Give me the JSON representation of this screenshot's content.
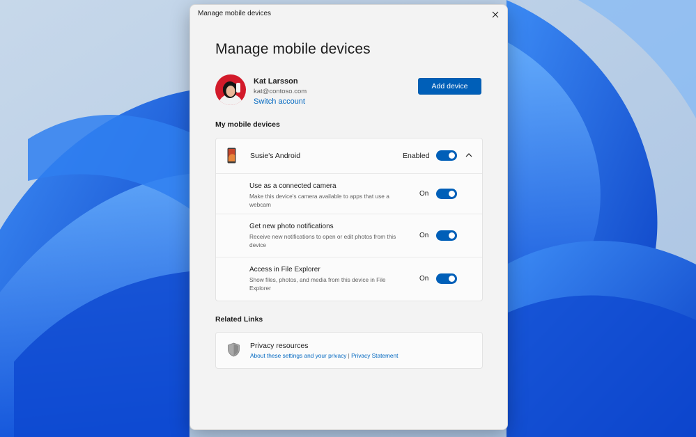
{
  "window": {
    "title": "Manage mobile devices"
  },
  "page": {
    "heading": "Manage mobile devices"
  },
  "account": {
    "name": "Kat Larsson",
    "email": "kat@contoso.com",
    "switch_label": "Switch account"
  },
  "add_device_label": "Add device",
  "devices_section": {
    "heading": "My mobile devices",
    "device": {
      "name": "Susie's Android",
      "status": "Enabled",
      "enabled": true,
      "expanded": true,
      "icon": "phone-icon"
    },
    "settings": [
      {
        "title": "Use as a connected camera",
        "description": "Make this device's camera available to apps that use a webcam",
        "state": "On",
        "on": true
      },
      {
        "title": "Get new photo notifications",
        "description": "Receive new notifications to open or edit photos from this device",
        "state": "On",
        "on": true
      },
      {
        "title": "Access in File Explorer",
        "description": "Show files, photos, and media from this device in File Explorer",
        "state": "On",
        "on": true
      }
    ]
  },
  "related": {
    "heading": "Related Links",
    "title": "Privacy resources",
    "link1": "About these settings and your privacy",
    "separator": " | ",
    "link2": "Privacy Statement",
    "icon": "shield-icon"
  },
  "colors": {
    "accent": "#005fb8",
    "link": "#0067c0",
    "window_bg": "#f3f3f3",
    "wallpaper": "#1a5fe0"
  }
}
